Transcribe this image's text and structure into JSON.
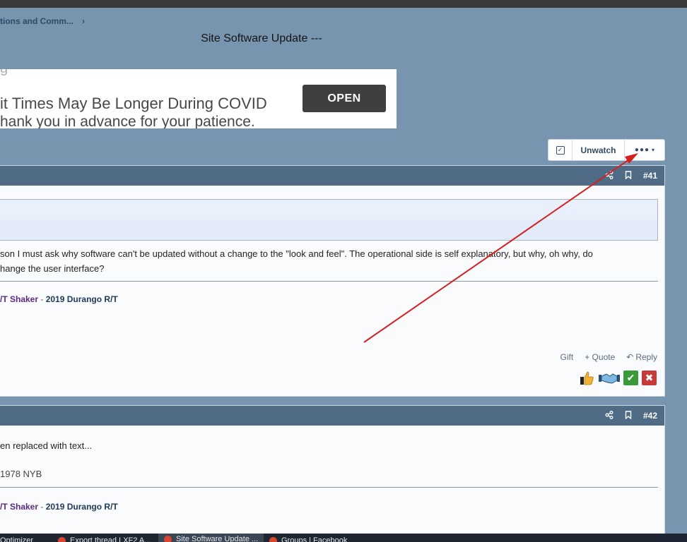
{
  "breadcrumb": {
    "last": "tions and Comm...",
    "chevron": "›"
  },
  "page_title": "Site Software Update ---",
  "ad": {
    "ghost": "g",
    "line1": "it Times May Be Longer During COVID",
    "line2": "hank you in advance for your patience.",
    "open_label": "OPEN"
  },
  "thread_tools": {
    "unwatch_label": "Unwatch",
    "more_dots": "●●●",
    "more_caret": "▾",
    "check_icon": "check-square-icon"
  },
  "posts": [
    {
      "number": "#41",
      "text_line1": "son I must ask why software can't be updated without a change to the \"look and feel\". The operational side is self explanatory, but why, oh why, do",
      "text_line2": "hange the user interface?",
      "sig_user": "/T Shaker",
      "sig_dash": " - ",
      "sig_car": "2019 Durango R/T",
      "actions": {
        "gift": "Gift",
        "quote": "+ Quote",
        "reply": "Reply",
        "reply_icon": "↶"
      },
      "reactions": [
        "thumbs-up-icon",
        "handshake-icon",
        "check-icon",
        "x-icon"
      ]
    },
    {
      "number": "#42",
      "text_line1": "en replaced with text...",
      "text_line2": "1978 NYB",
      "sig_user": "/T Shaker",
      "sig_dash": " - ",
      "sig_car": "2019 Durango R/T"
    }
  ],
  "taskbar": [
    {
      "label": "Optimizer"
    },
    {
      "label": "Export thread LXF2 A..."
    },
    {
      "label": "Site Software Update ..."
    },
    {
      "label": "Groups | Facebook"
    }
  ],
  "colors": {
    "background": "#7895b0",
    "post_header": "#4f6b86",
    "annotation_arrow": "#d62020"
  }
}
